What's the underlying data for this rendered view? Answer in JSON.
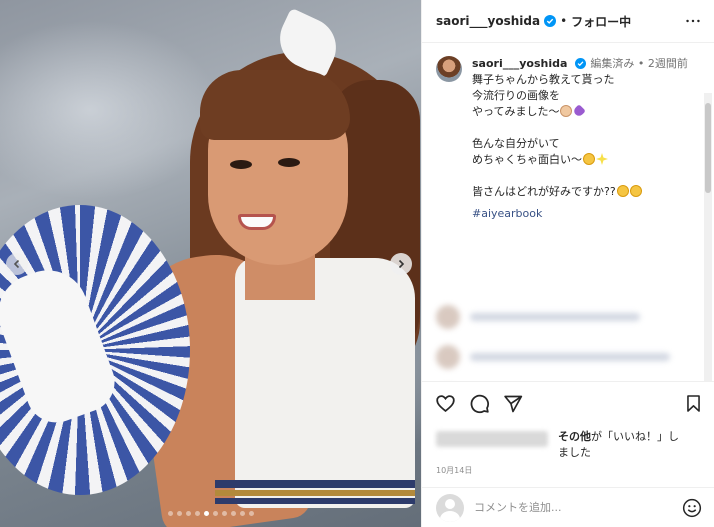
{
  "header": {
    "username": "saori___yoshida",
    "separator": "•",
    "follow_label": "フォロー中"
  },
  "caption": {
    "username": "saori___yoshida",
    "edited": "編集済み",
    "separator": "•",
    "time": "2週間前",
    "line1": "舞子ちゃんから教えて貰った",
    "line2": "今流行りの画像を",
    "line3": "やってみました〜",
    "line4": "色んな自分がいて",
    "line5": "めちゃくちゃ面白い〜",
    "line6": "皆さんはどれが好みですか??",
    "hashtag": "#aiyearbook"
  },
  "likes": {
    "text_bold": "その他",
    "text_rest": "が「いいね！」し",
    "text_line2": "ました"
  },
  "date": "10月14日",
  "comment_box": {
    "placeholder": "コメントを追加..."
  },
  "icons": {
    "more": "more-icon",
    "like": "heart-icon",
    "comment": "comment-icon",
    "share": "share-icon",
    "save": "bookmark-icon",
    "emoji": "emoji-icon",
    "verified": "verified-badge-icon",
    "next": "chevron-right-icon"
  },
  "carousel": {
    "total": 10,
    "active_index": 4
  },
  "colors": {
    "verified": "#0095f6",
    "hashtag": "#385185",
    "text": "#262626",
    "muted": "#737373"
  }
}
